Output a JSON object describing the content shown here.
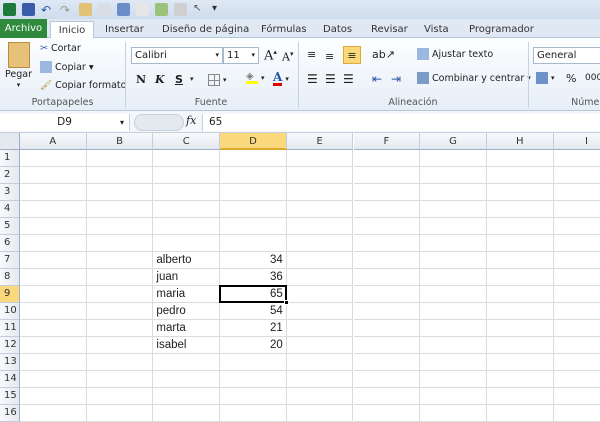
{
  "quick_access": [
    "excel-icon",
    "save-icon",
    "undo-icon",
    "redo-icon",
    "print-preview-icon",
    "print-icon",
    "form-icon",
    "sort-icon",
    "refresh-icon",
    "filter-icon",
    "select-icon",
    "customize-icon"
  ],
  "tabs": {
    "file": "Archivo",
    "items": [
      "Inicio",
      "Insertar",
      "Diseño de página",
      "Fórmulas",
      "Datos",
      "Revisar",
      "Vista",
      "Programador"
    ],
    "active": "Inicio"
  },
  "clipboard": {
    "paste": "Pegar",
    "cut": "Cortar",
    "copy": "Copiar",
    "format_painter": "Copiar formato",
    "label": "Portapapeles"
  },
  "font": {
    "name": "Calibri",
    "size": "11",
    "bold": "N",
    "italic": "K",
    "underline": "S",
    "label": "Fuente",
    "fill_color": "#ffff00",
    "font_color": "#e00000"
  },
  "alignment": {
    "wrap": "Ajustar texto",
    "merge": "Combinar y centrar",
    "label": "Alineación"
  },
  "number": {
    "format": "General",
    "percent": "%",
    "thousands": "000",
    "label": "Número"
  },
  "formula_bar": {
    "name_box": "D9",
    "fx": "fx",
    "value": "65"
  },
  "sheet": {
    "columns": [
      "A",
      "B",
      "C",
      "D",
      "E",
      "F",
      "G",
      "H",
      "I"
    ],
    "selected_column": "D",
    "selected_row": 9,
    "rows": [
      1,
      2,
      3,
      4,
      5,
      6,
      7,
      8,
      9,
      10,
      11,
      12,
      13,
      14,
      15,
      16
    ],
    "cells": [
      {
        "ref": "C7",
        "value": "alberto"
      },
      {
        "ref": "D7",
        "value": "34"
      },
      {
        "ref": "C8",
        "value": "juan"
      },
      {
        "ref": "D8",
        "value": "36"
      },
      {
        "ref": "C9",
        "value": "maria"
      },
      {
        "ref": "D9",
        "value": "65"
      },
      {
        "ref": "C10",
        "value": "pedro"
      },
      {
        "ref": "D10",
        "value": "54"
      },
      {
        "ref": "C11",
        "value": "marta"
      },
      {
        "ref": "D11",
        "value": "21"
      },
      {
        "ref": "C12",
        "value": "isabel"
      },
      {
        "ref": "D12",
        "value": "20"
      }
    ]
  }
}
